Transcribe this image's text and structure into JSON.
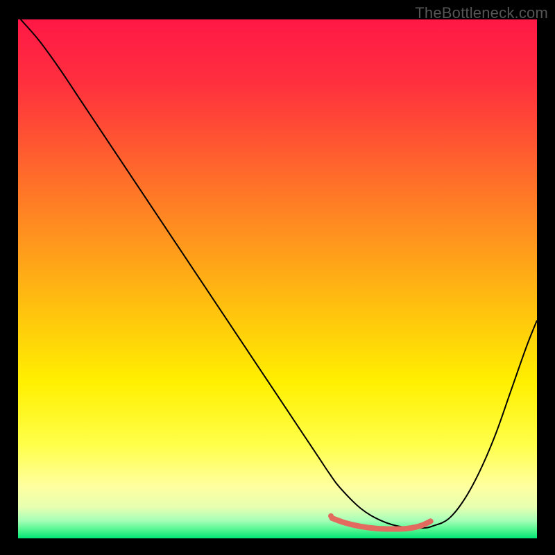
{
  "watermark": "TheBottleneck.com",
  "chart_data": {
    "type": "line",
    "title": "",
    "xlabel": "",
    "ylabel": "",
    "xlim": [
      0,
      100
    ],
    "ylim": [
      0,
      100
    ],
    "grid": false,
    "legend": false,
    "gradient_stops": [
      {
        "offset": 0.0,
        "color": "#ff1846"
      },
      {
        "offset": 0.12,
        "color": "#ff2f3e"
      },
      {
        "offset": 0.25,
        "color": "#ff5a30"
      },
      {
        "offset": 0.4,
        "color": "#ff8d20"
      },
      {
        "offset": 0.55,
        "color": "#ffbf0f"
      },
      {
        "offset": 0.7,
        "color": "#fff000"
      },
      {
        "offset": 0.82,
        "color": "#ffff4a"
      },
      {
        "offset": 0.9,
        "color": "#ffffa0"
      },
      {
        "offset": 0.94,
        "color": "#e6ffb0"
      },
      {
        "offset": 0.965,
        "color": "#a8ffb8"
      },
      {
        "offset": 0.985,
        "color": "#4cf58e"
      },
      {
        "offset": 1.0,
        "color": "#00e676"
      }
    ],
    "series": [
      {
        "name": "bottleneck-curve",
        "color": "#000000",
        "stroke_width": 2,
        "x": [
          0.5,
          4,
          8,
          12,
          16,
          20,
          24,
          28,
          32,
          36,
          40,
          44,
          48,
          52,
          55,
          58,
          60,
          62,
          66,
          70,
          74,
          78,
          80,
          83,
          86,
          89,
          92,
          95,
          98,
          100
        ],
        "y": [
          100,
          96,
          90.5,
          84.5,
          78.5,
          72.5,
          66.5,
          60.5,
          54.5,
          48.5,
          42.5,
          36.5,
          30.5,
          24.5,
          20,
          15.5,
          12.5,
          9.8,
          5.8,
          3.4,
          2.2,
          2.0,
          2.4,
          3.8,
          7.5,
          13,
          20,
          28.5,
          37,
          42
        ],
        "smooth": true
      },
      {
        "name": "min-highlight",
        "color": "#e26a5f",
        "stroke_width": 8,
        "linecap": "round",
        "x": [
          60.5,
          63,
          66,
          69,
          72,
          75,
          77.5,
          79.5
        ],
        "y": [
          3.9,
          3.0,
          2.3,
          1.9,
          1.8,
          1.9,
          2.4,
          3.3
        ],
        "smooth": true
      }
    ],
    "markers": [
      {
        "name": "left-end-dot",
        "x": 60.3,
        "y": 4.3,
        "r": 4,
        "color": "#e26a5f"
      }
    ]
  }
}
